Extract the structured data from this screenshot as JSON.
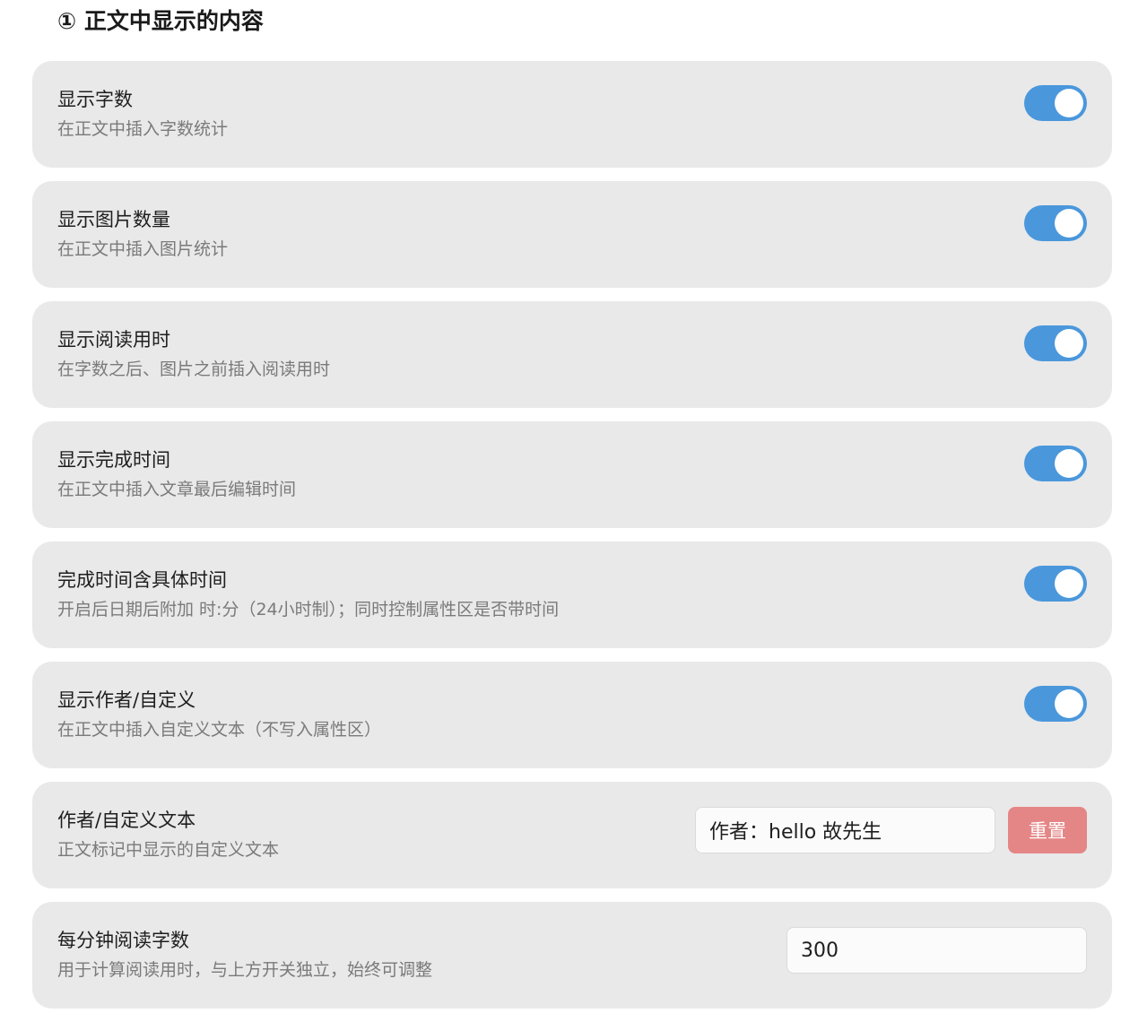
{
  "section": {
    "title": "① 正文中显示的内容"
  },
  "settings": [
    {
      "title": "显示字数",
      "desc": "在正文中插入字数统计",
      "enabled": true
    },
    {
      "title": "显示图片数量",
      "desc": "在正文中插入图片统计",
      "enabled": true
    },
    {
      "title": "显示阅读用时",
      "desc": "在字数之后、图片之前插入阅读用时",
      "enabled": true
    },
    {
      "title": "显示完成时间",
      "desc": "在正文中插入文章最后编辑时间",
      "enabled": true
    },
    {
      "title": "完成时间含具体时间",
      "desc": "开启后日期后附加 时:分（24小时制）；同时控制属性区是否带时间",
      "enabled": true
    },
    {
      "title": "显示作者/自定义",
      "desc": "在正文中插入自定义文本（不写入属性区）",
      "enabled": true
    }
  ],
  "author": {
    "title": "作者/自定义文本",
    "desc": "正文标记中显示的自定义文本",
    "value": "作者：hello 故先生",
    "reset_label": "重置"
  },
  "wpm": {
    "title": "每分钟阅读字数",
    "desc": "用于计算阅读用时，与上方开关独立，始终可调整",
    "value": "300"
  },
  "colors": {
    "toggle_on": "#4a97dc",
    "reset_button": "#e58686",
    "card_bg": "#e9e9e9"
  }
}
